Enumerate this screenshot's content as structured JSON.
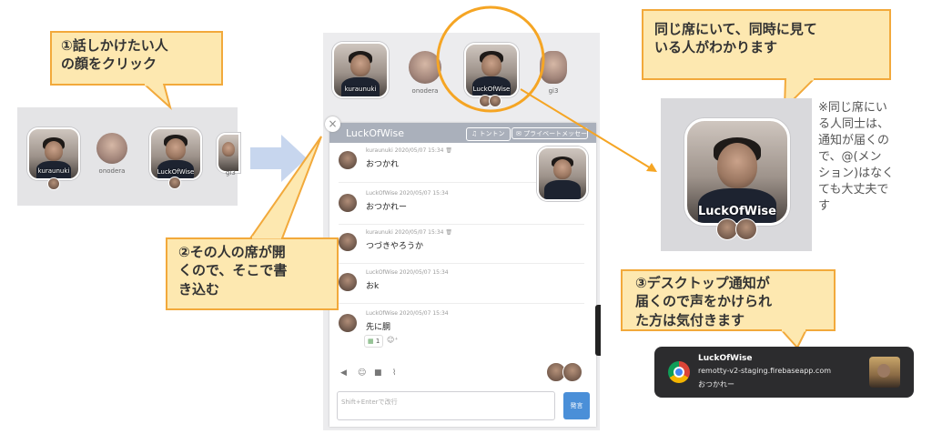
{
  "callouts": {
    "step1_line1": "①話しかけたい人",
    "step1_line2": "の顔をクリック",
    "step2_line1": "②その人の席が開",
    "step2_line2": "くので、そこで書",
    "step2_line3": "き込む",
    "seat_line1": "同じ席にいて、同時に見て",
    "seat_line2": "いる人がわかります",
    "step3_line1": "③デスクトップ通知が",
    "step3_line2": "届くので声をかけられ",
    "step3_line3": "た方は気付きます"
  },
  "note": {
    "lines": [
      "※同じ席にい",
      "る人同士は、",
      "通知が届くの",
      "で、@(メン",
      "ション)はなく",
      "ても大丈夫で",
      "す"
    ]
  },
  "left_strip": {
    "users": [
      {
        "name": "kuraunuki"
      },
      {
        "name": "onodera"
      },
      {
        "name": "LuckOfWise"
      },
      {
        "name": "gi3"
      }
    ]
  },
  "top_strip": {
    "users": [
      {
        "name": "kuraunuki"
      },
      {
        "name": "onodera"
      },
      {
        "name": "LuckOfWise"
      },
      {
        "name": "gi3"
      }
    ]
  },
  "chat": {
    "title": "LuckOfWise",
    "tontoon_label": "トントン",
    "private_label": "プライベートメッセージ",
    "close_label": "×",
    "messages": [
      {
        "meta": "kuraunuki  2020/05/07 15:34 🗑",
        "text": "おつかれ"
      },
      {
        "meta": "LuckOfWise  2020/05/07 15:34",
        "text": "おつかれー"
      },
      {
        "meta": "kuraunuki  2020/05/07 15:34 🗑",
        "text": "つづきやろうか"
      },
      {
        "meta": "LuckOfWise  2020/05/07 15:34",
        "text": "おk"
      },
      {
        "meta": "LuckOfWise  2020/05/07 15:34",
        "text": "先に胴"
      }
    ],
    "reaction_count": "1",
    "input_placeholder": "Shift+Enterで改行",
    "send_label": "発言"
  },
  "zoom_tile": {
    "name": "LuckOfWise"
  },
  "notification": {
    "title": "LuckOfWise",
    "domain": "remotty-v2-staging.firebaseapp.com",
    "body": "おつかれー"
  },
  "colors": {
    "callout_fill": "#fde8b0",
    "callout_border": "#f2a93b",
    "chat_header": "#aab0bb",
    "send_button": "#4a8fd8",
    "arrow": "#c7d6ee"
  }
}
